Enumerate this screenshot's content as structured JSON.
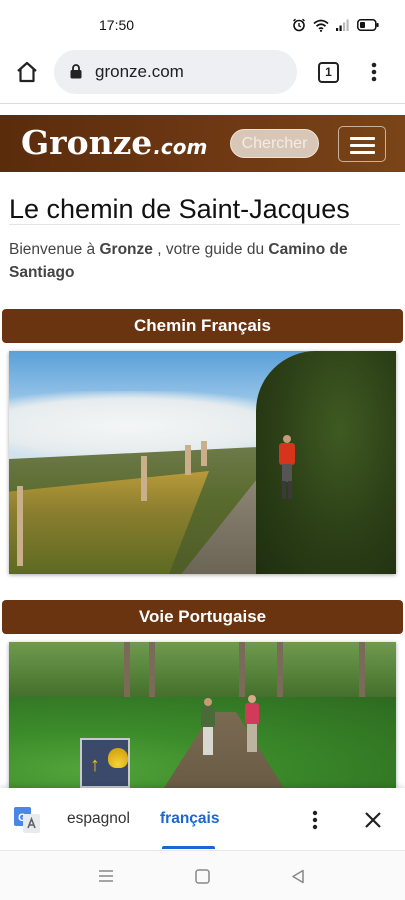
{
  "status_bar": {
    "time": "17:50"
  },
  "browser": {
    "url": "gronze.com",
    "tab_count": "1"
  },
  "site": {
    "logo_main": "Gronze",
    "logo_suffix": ".com",
    "search_placeholder": "Chercher"
  },
  "page": {
    "title": "Le chemin de Saint-Jacques",
    "intro_prefix": "Bienvenue à ",
    "intro_brand": "Gronze",
    "intro_middle": " , votre guide du ",
    "intro_camino": "Camino de Santiago",
    "sections": [
      {
        "label": "Chemin Français"
      },
      {
        "label": "Voie Portugaise"
      }
    ]
  },
  "translate_bar": {
    "source_language": "espagnol",
    "target_language": "français",
    "selected": "français"
  },
  "colors": {
    "header_brown": "#6b3612",
    "section_brown": "#6a3410",
    "translate_accent": "#1a66d2"
  }
}
